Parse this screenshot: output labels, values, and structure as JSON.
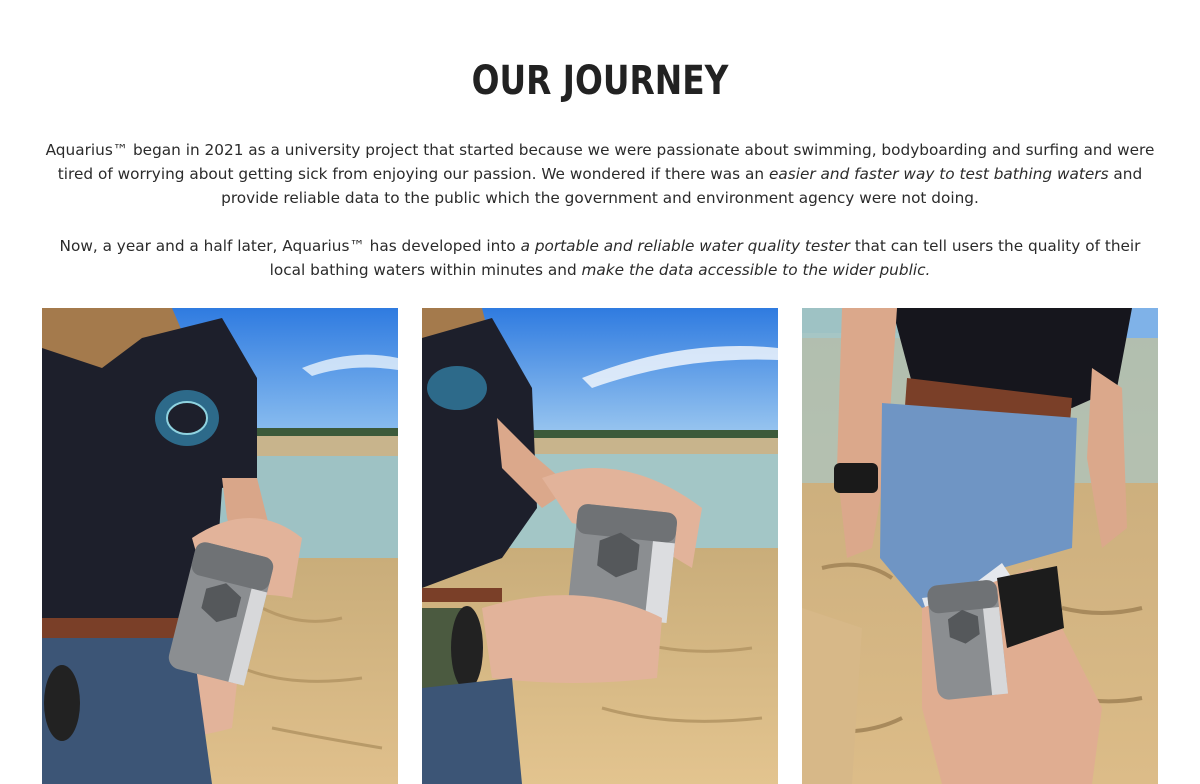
{
  "section": {
    "title": "OUR JOURNEY",
    "paragraph1": {
      "part1": "Aquarius™ began in 2021 as a university project that started because we were passionate about swimming, bodyboarding and surfing and were tired of worrying about getting sick from enjoying our passion. We wondered if there was an ",
      "emphasis1": "easier and faster way to test bathing waters",
      "part2": " and provide reliable data to the public which the government and environment agency were not doing."
    },
    "paragraph2": {
      "part1": "Now, a year and a half later, Aquarius™ has developed into ",
      "emphasis1": "a portable and reliable water quality tester",
      "part2": " that can tell users the quality of their local bathing waters within minutes and ",
      "emphasis2": "make the data accessible to the wider public."
    }
  },
  "gallery": {
    "photos": [
      {
        "subject": "person-holding-device-photo"
      },
      {
        "subject": "hand-on-device-photo"
      },
      {
        "subject": "device-strapped-to-leg-photo"
      }
    ]
  },
  "colors": {
    "sky": "#4a8fe0",
    "sand": "#d9b880",
    "water": "#9fc4c8",
    "shirt": "#1c1e2a",
    "device": "#8a8d90",
    "denim": "#6f95c4"
  }
}
